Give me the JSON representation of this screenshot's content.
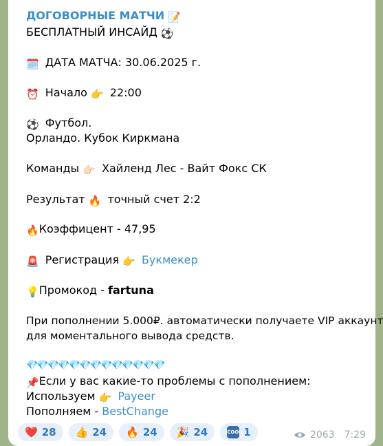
{
  "message": {
    "title": "ДОГОВОРНЫЕ МАТЧИ",
    "title_emoji": "📝",
    "subtitle": "БЕСПЛАТНЫЙ ИНСАЙД",
    "subtitle_emoji": "⚽",
    "date_emoji": "🗓️",
    "date_text": "ДАТА МАТЧА: 30.06.2025 г.",
    "start_emoji": "⏰",
    "start_label": "Начало",
    "start_point_emoji": "👉",
    "start_time": "22:00",
    "sport_emoji": "⚽",
    "sport": "Футбол.",
    "tournament": "Орландо. Кубок Киркмана",
    "teams_label": "Команды",
    "teams_point_emoji": "👉🏻",
    "teams": "Хайленд Лес - Вайт Фокс СК",
    "result_label": "Результат",
    "result_emoji": "🔥",
    "result_value": "точный счет 2:2",
    "coef_emoji": "🔥",
    "coef_text": "Коэффицент - 47,95",
    "reg_emoji": "🚨",
    "reg_label": "Регистрация",
    "reg_point_emoji": "👉",
    "reg_link": "Букмекер",
    "promo_emoji": "💡",
    "promo_label": "Промокод - ",
    "promo_code": "fartuna",
    "deposit_line1": "При пополнении 5.000₽.  автоматически получаете VIP аккаунт",
    "deposit_line2": "для моментального вывода средств.",
    "diamonds": "💎💎💎💎💎💎💎💎💎💎💎💎💎",
    "pin_emoji": "📌",
    "problem_text": "Если у вас какие-то  проблемы с пополнением:",
    "use_label": "Используем",
    "use_point_emoji": "👉",
    "use_link": "Payeer",
    "refill_label": "Пополняем - ",
    "refill_link": "BestChange"
  },
  "reactions": [
    {
      "emoji": "❤️",
      "count": "28"
    },
    {
      "emoji": "👍",
      "count": "24"
    },
    {
      "emoji": "🔥",
      "count": "24"
    },
    {
      "emoji": "🎉",
      "count": "24"
    },
    {
      "emoji": "COOL",
      "count": "1"
    }
  ],
  "meta": {
    "views": "2063",
    "time": "7:29"
  }
}
